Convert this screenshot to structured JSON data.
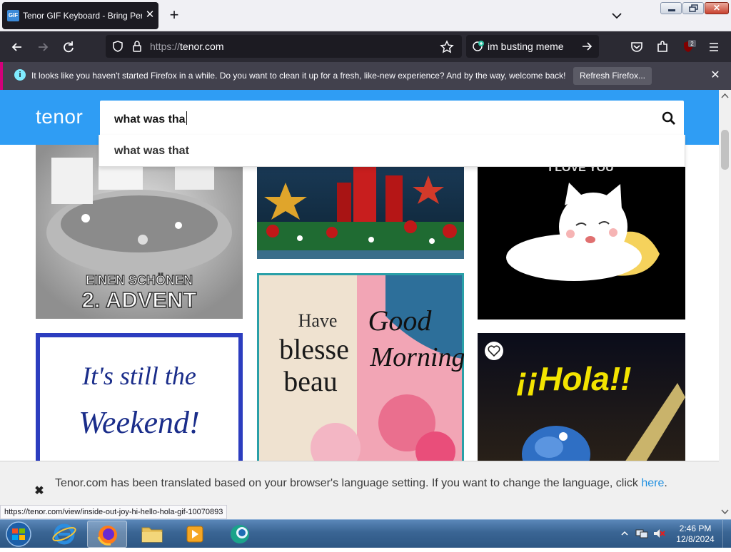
{
  "browser": {
    "tab": {
      "title": "Tenor GIF Keyboard - Bring Personality To Your Conversations",
      "favicon_text": "GIF"
    },
    "url": {
      "scheme": "https://",
      "host": "tenor.com"
    },
    "search_box": {
      "value": "im busting meme"
    },
    "notification": {
      "message": "It looks like you haven't started Firefox in a while. Do you want to clean it up for a fresh, like-new experience? And by the way, welcome back!",
      "button_label": "Refresh Firefox..."
    },
    "extension_badge": "2"
  },
  "page": {
    "logo": "tenor",
    "search": {
      "value": "what was tha"
    },
    "suggestions": [
      "what was that"
    ],
    "gifs": [
      {
        "caption_lines": [
          "EINEN SCHÖNEN",
          "2. ADVENT"
        ]
      },
      {
        "caption_lines": []
      },
      {
        "caption_lines": [
          "I LOVE YOU"
        ]
      },
      {
        "caption_lines": [
          "It's still the",
          "Weekend!"
        ]
      },
      {
        "caption_lines": [
          "Have",
          "blesse",
          "beau",
          "Good",
          "Morning"
        ]
      },
      {
        "caption_lines": [
          "¡¡Hola!!"
        ]
      }
    ],
    "translate_notice": {
      "text": "Tenor.com has been translated based on your browser's language setting. If you want to change the language, click",
      "link": "here",
      "suffix": "."
    },
    "status_url": "https://tenor.com/view/inside-out-joy-hi-hello-hola-gif-10070893"
  },
  "taskbar": {
    "time": "2:46 PM",
    "date": "12/8/2024"
  },
  "colors": {
    "tenor_blue": "#2f9df4",
    "firefox_dark": "#2b2a33",
    "link": "#1e8fe0"
  }
}
